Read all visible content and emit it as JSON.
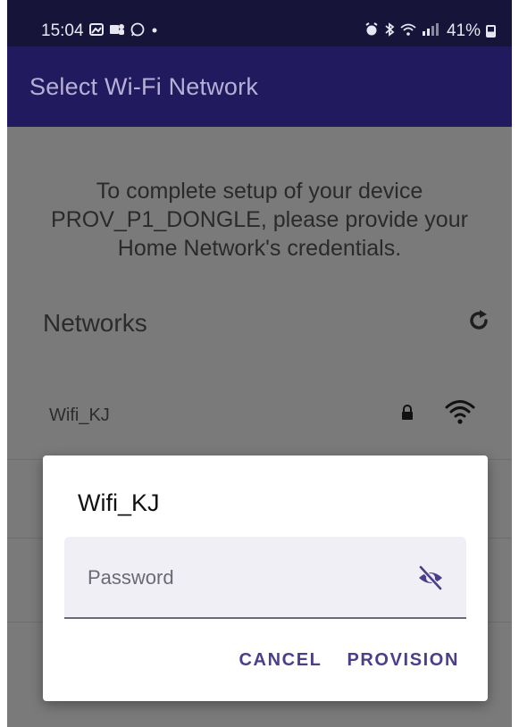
{
  "status_bar": {
    "time": "15:04",
    "battery": "41%",
    "left_icons": [
      "gallery-icon",
      "teams-icon",
      "whatsapp-icon",
      "dot-icon"
    ],
    "right_icons": [
      "alarm-icon",
      "bluetooth-icon",
      "wifi-icon",
      "signal-icon"
    ]
  },
  "app_bar": {
    "title": "Select Wi-Fi Network"
  },
  "content": {
    "intro_line1": "To complete setup of your device",
    "intro_line2": "PROV_P1_DONGLE, please provide your",
    "intro_line3": "Home Network's credentials.",
    "networks_heading": "Networks",
    "networks": [
      {
        "name": "Wifi_KJ",
        "secured": true,
        "signal": "full"
      }
    ]
  },
  "dialog": {
    "title": "Wifi_KJ",
    "password_placeholder": "Password",
    "password_value": "",
    "cancel_label": "CANCEL",
    "provision_label": "PROVISION"
  },
  "colors": {
    "status_bar_bg": "#17143a",
    "app_bar_bg": "#221a5e",
    "accent": "#4b3f8a",
    "scrim": "#7a7a7a"
  }
}
